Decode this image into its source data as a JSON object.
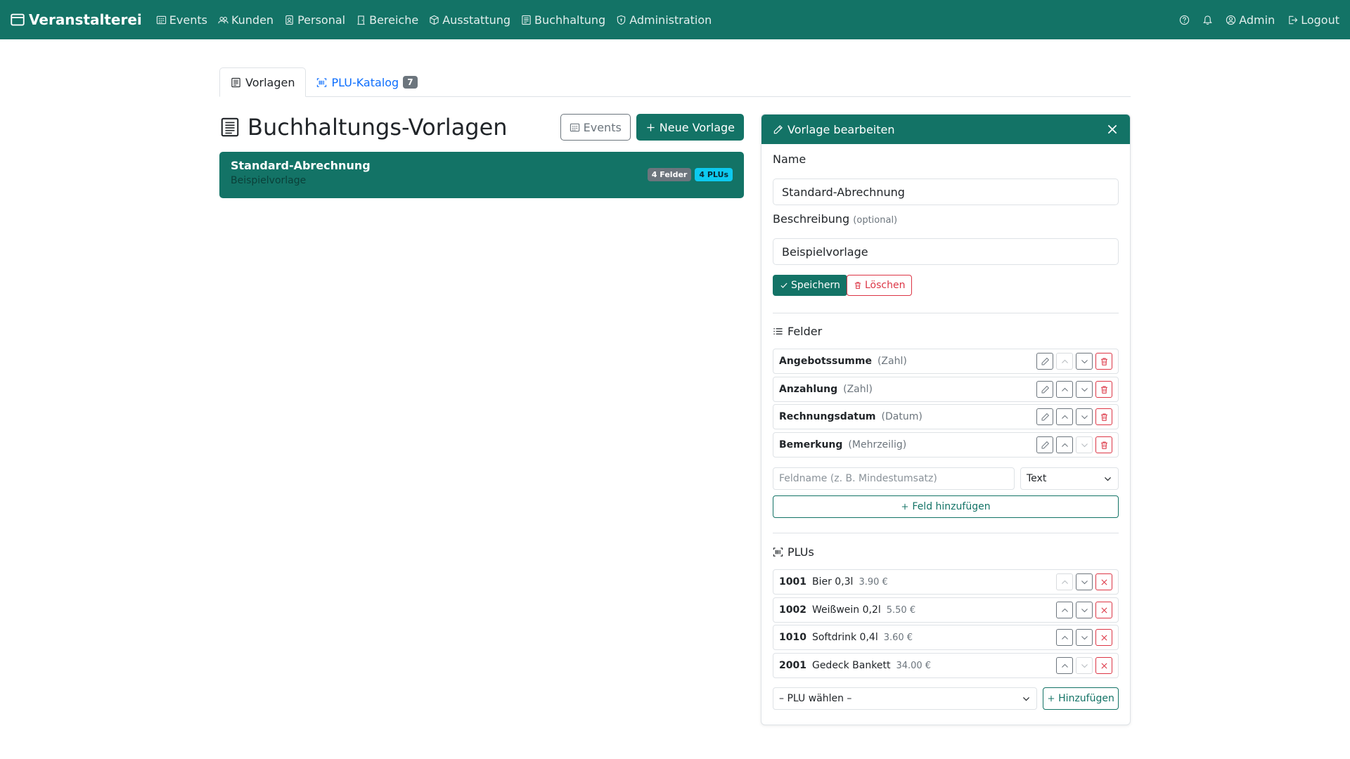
{
  "navbar": {
    "brand": "Veranstalterei",
    "items": [
      {
        "label": "Events",
        "icon": "calendar-grid-icon"
      },
      {
        "label": "Kunden",
        "icon": "people-icon"
      },
      {
        "label": "Personal",
        "icon": "person-badge-icon"
      },
      {
        "label": "Bereiche",
        "icon": "door-icon"
      },
      {
        "label": "Ausstattung",
        "icon": "box-icon"
      },
      {
        "label": "Buchhaltung",
        "icon": "ledger-icon"
      },
      {
        "label": "Administration",
        "icon": "shield-icon"
      }
    ],
    "user": "Admin",
    "logout": "Logout"
  },
  "tabs": {
    "vorlagen": "Vorlagen",
    "plu_katalog": "PLU-Katalog",
    "plu_count": "7"
  },
  "page": {
    "title": "Buchhaltungs-Vorlagen",
    "events_button": "Events",
    "new_button": "Neue Vorlage"
  },
  "templates": [
    {
      "name": "Standard-Abrechnung",
      "description": "Beispielvorlage",
      "fields_badge": "4 Felder",
      "plus_badge": "4 PLUs"
    }
  ],
  "editor": {
    "header": "Vorlage bearbeiten",
    "name_label": "Name",
    "name_value": "Standard-Abrechnung",
    "desc_label": "Beschreibung",
    "desc_optional": "(optional)",
    "desc_value": "Beispielvorlage",
    "save": "Speichern",
    "delete": "Löschen",
    "fields_title": "Felder",
    "fields": [
      {
        "name": "Angebotssumme",
        "type": "(Zahl)"
      },
      {
        "name": "Anzahlung",
        "type": "(Zahl)"
      },
      {
        "name": "Rechnungsdatum",
        "type": "(Datum)"
      },
      {
        "name": "Bemerkung",
        "type": "(Mehrzeilig)"
      }
    ],
    "field_name_placeholder": "Feldname (z. B. Mindestumsatz)",
    "field_type_value": "Text",
    "add_field": "Feld hinzufügen",
    "plus_title": "PLUs",
    "plus": [
      {
        "code": "1001",
        "name": "Bier 0,3l",
        "price": "3.90 €"
      },
      {
        "code": "1002",
        "name": "Weißwein 0,2l",
        "price": "5.50 €"
      },
      {
        "code": "1010",
        "name": "Softdrink 0,4l",
        "price": "3.60 €"
      },
      {
        "code": "2001",
        "name": "Gedeck Bankett",
        "price": "34.00 €"
      }
    ],
    "plu_select_value": "– PLU wählen –",
    "add_plu": "Hinzufügen"
  },
  "colors": {
    "primary": "#137366",
    "danger": "#dc3545",
    "info": "#0dcaf0",
    "secondary": "#6c757d"
  }
}
